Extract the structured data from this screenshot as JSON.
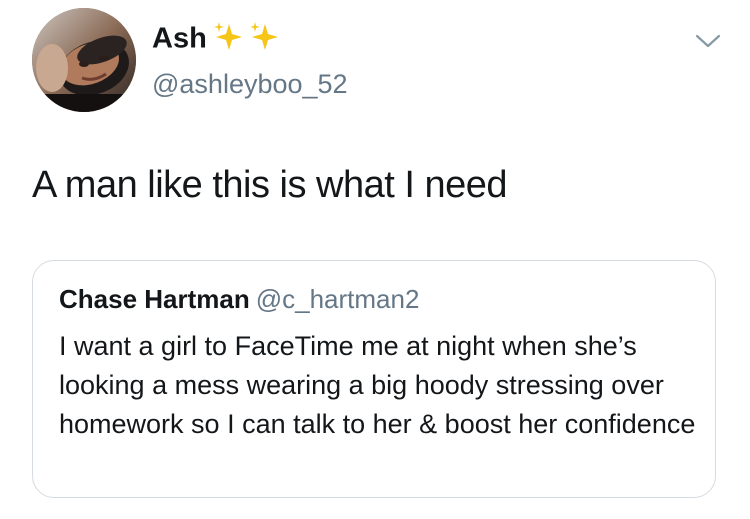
{
  "author": {
    "display_name": "Ash",
    "handle": "@ashleyboo_52",
    "name_emoji": "sparkles-icon"
  },
  "tweet": {
    "text": "A man like this is what I need"
  },
  "quoted_tweet": {
    "display_name": "Chase Hartman",
    "handle": "@c_hartman2",
    "text": "I want a girl to FaceTime me at night when she’s looking a mess wearing a big hoody stressing over homework so I can talk to her & boost her confidence"
  },
  "menu": {
    "icon": "chevron-down-icon"
  },
  "colors": {
    "text_primary": "#14171a",
    "text_secondary": "#657786",
    "border": "#d6dbe0",
    "sparkle": "#f5c518"
  }
}
